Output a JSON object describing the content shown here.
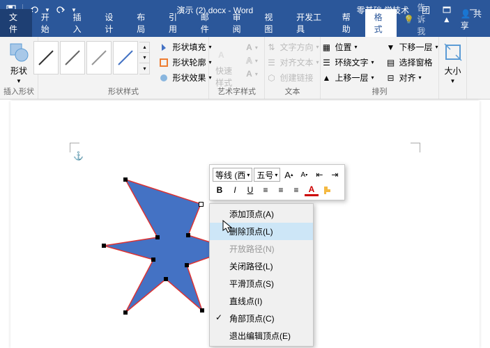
{
  "title": "演示 (2).docx - Word",
  "topRight": {
    "brand": "零基础 学技术",
    "team": "团"
  },
  "share": "共享",
  "tabs": {
    "file": "文件",
    "home": "开始",
    "insert": "插入",
    "design": "设计",
    "layout": "布局",
    "references": "引用",
    "mailings": "邮件",
    "review": "审阅",
    "view": "视图",
    "developer": "开发工具",
    "help": "帮助",
    "format": "格式",
    "tellme": "告诉我"
  },
  "ribbon": {
    "insertShapes": {
      "label": "插入形状",
      "shape": "形状"
    },
    "shapeStyles": {
      "label": "形状样式",
      "fill": "形状填充",
      "outline": "形状轮廓",
      "effects": "形状效果"
    },
    "wordart": {
      "label": "艺术字样式",
      "quick": "快速样式"
    },
    "text": {
      "label": "文本",
      "direction": "文字方向",
      "align": "对齐文本",
      "link": "创建链接"
    },
    "arrange": {
      "label": "排列",
      "position": "位置",
      "wrap": "环绕文字",
      "forward": "上移一层",
      "backward": "下移一层",
      "pane": "选择窗格",
      "alignBtn": "对齐"
    },
    "size": {
      "label": "大小"
    }
  },
  "miniToolbar": {
    "font": "等线 (西",
    "size": "五号",
    "bold": "B",
    "italic": "I",
    "underline": "U"
  },
  "contextMenu": {
    "addVertex": "添加顶点(A)",
    "deleteVertex": "删除顶点(L)",
    "openPath": "开放路径(N)",
    "closePath": "关闭路径(L)",
    "smoothVertex": "平滑顶点(S)",
    "straightLine": "直线点(I)",
    "cornerPoint": "角部顶点(C)",
    "exitEdit": "退出编辑顶点(E)"
  }
}
